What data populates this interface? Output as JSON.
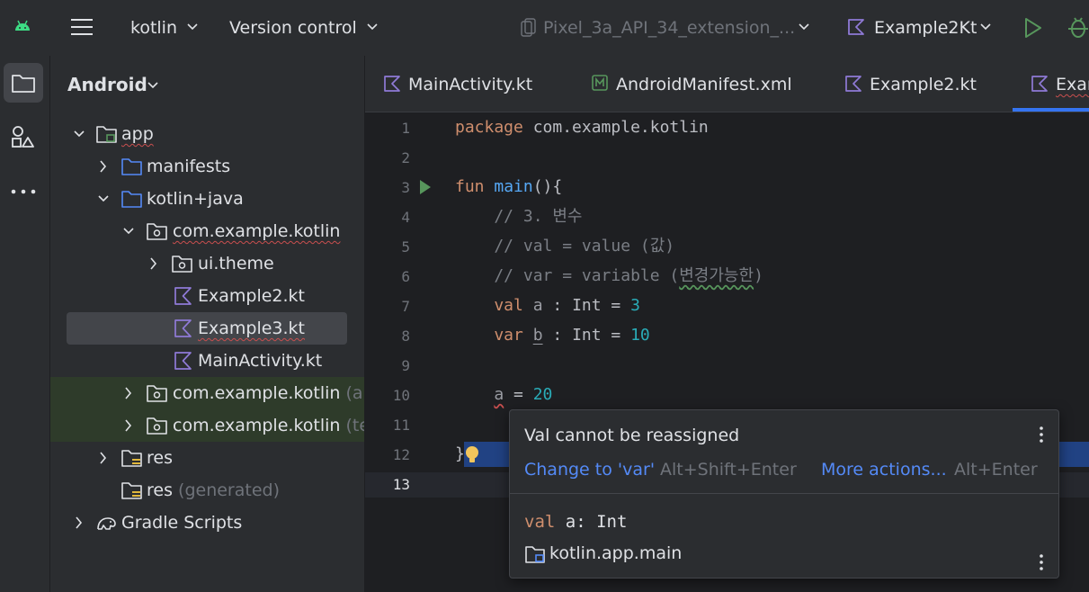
{
  "toolbar": {
    "project_name": "kotlin",
    "vcs_label": "Version control",
    "device": "Pixel_3a_API_34_extension_...",
    "run_config": "Example2Kt"
  },
  "project_panel": {
    "view_mode": "Android",
    "tree": [
      {
        "label": "app",
        "suffix": ""
      },
      {
        "label": "manifests",
        "suffix": ""
      },
      {
        "label": "kotlin+java",
        "suffix": ""
      },
      {
        "label": "com.example.kotlin",
        "suffix": ""
      },
      {
        "label": "ui.theme",
        "suffix": ""
      },
      {
        "label": "Example2.kt",
        "suffix": ""
      },
      {
        "label": "Example3.kt",
        "suffix": ""
      },
      {
        "label": "MainActivity.kt",
        "suffix": ""
      },
      {
        "label": "com.example.kotlin",
        "suffix": "(an"
      },
      {
        "label": "com.example.kotlin",
        "suffix": "(tes"
      },
      {
        "label": "res",
        "suffix": ""
      },
      {
        "label": "res",
        "suffix": "(generated)"
      },
      {
        "label": "Gradle Scripts",
        "suffix": ""
      }
    ]
  },
  "editor": {
    "tabs": [
      {
        "label": "MainActivity.kt"
      },
      {
        "label": "AndroidManifest.xml"
      },
      {
        "label": "Example2.kt"
      },
      {
        "label": "Exam"
      }
    ],
    "line_numbers": [
      "1",
      "2",
      "3",
      "4",
      "5",
      "6",
      "7",
      "8",
      "9",
      "10",
      "11",
      "12",
      "13"
    ],
    "code": {
      "l1_kw": "package",
      "l1_rest": " com.example.kotlin",
      "l3_kw": "fun",
      "l3_fn": " main",
      "l3_rest": "(){",
      "l4": "    // 3. 변수",
      "l5": "    // val = value (값)",
      "l6_a": "    // var = variable (",
      "l6_b": "변경가능한",
      "l6_c": ")",
      "l7_kw": "    val",
      "l7_var": " a",
      "l7_sep": " : ",
      "l7_type": "Int",
      "l7_eq": " = ",
      "l7_num": "3",
      "l8_kw": "    var",
      "l8_var": "b",
      "l8_sep": " : ",
      "l8_type": "Int",
      "l8_eq": " = ",
      "l8_num": "10",
      "l10_var": "a",
      "l10_eq": " = ",
      "l10_num": "20",
      "l12": "}"
    }
  },
  "popup": {
    "message": "Val cannot be reassigned",
    "fix_label": "Change to 'var'",
    "fix_shortcut": "Alt+Shift+Enter",
    "more_label": "More actions...",
    "more_shortcut": "Alt+Enter",
    "decl_kw": "val",
    "decl_rest": " a: Int",
    "location": "kotlin.app.main"
  }
}
